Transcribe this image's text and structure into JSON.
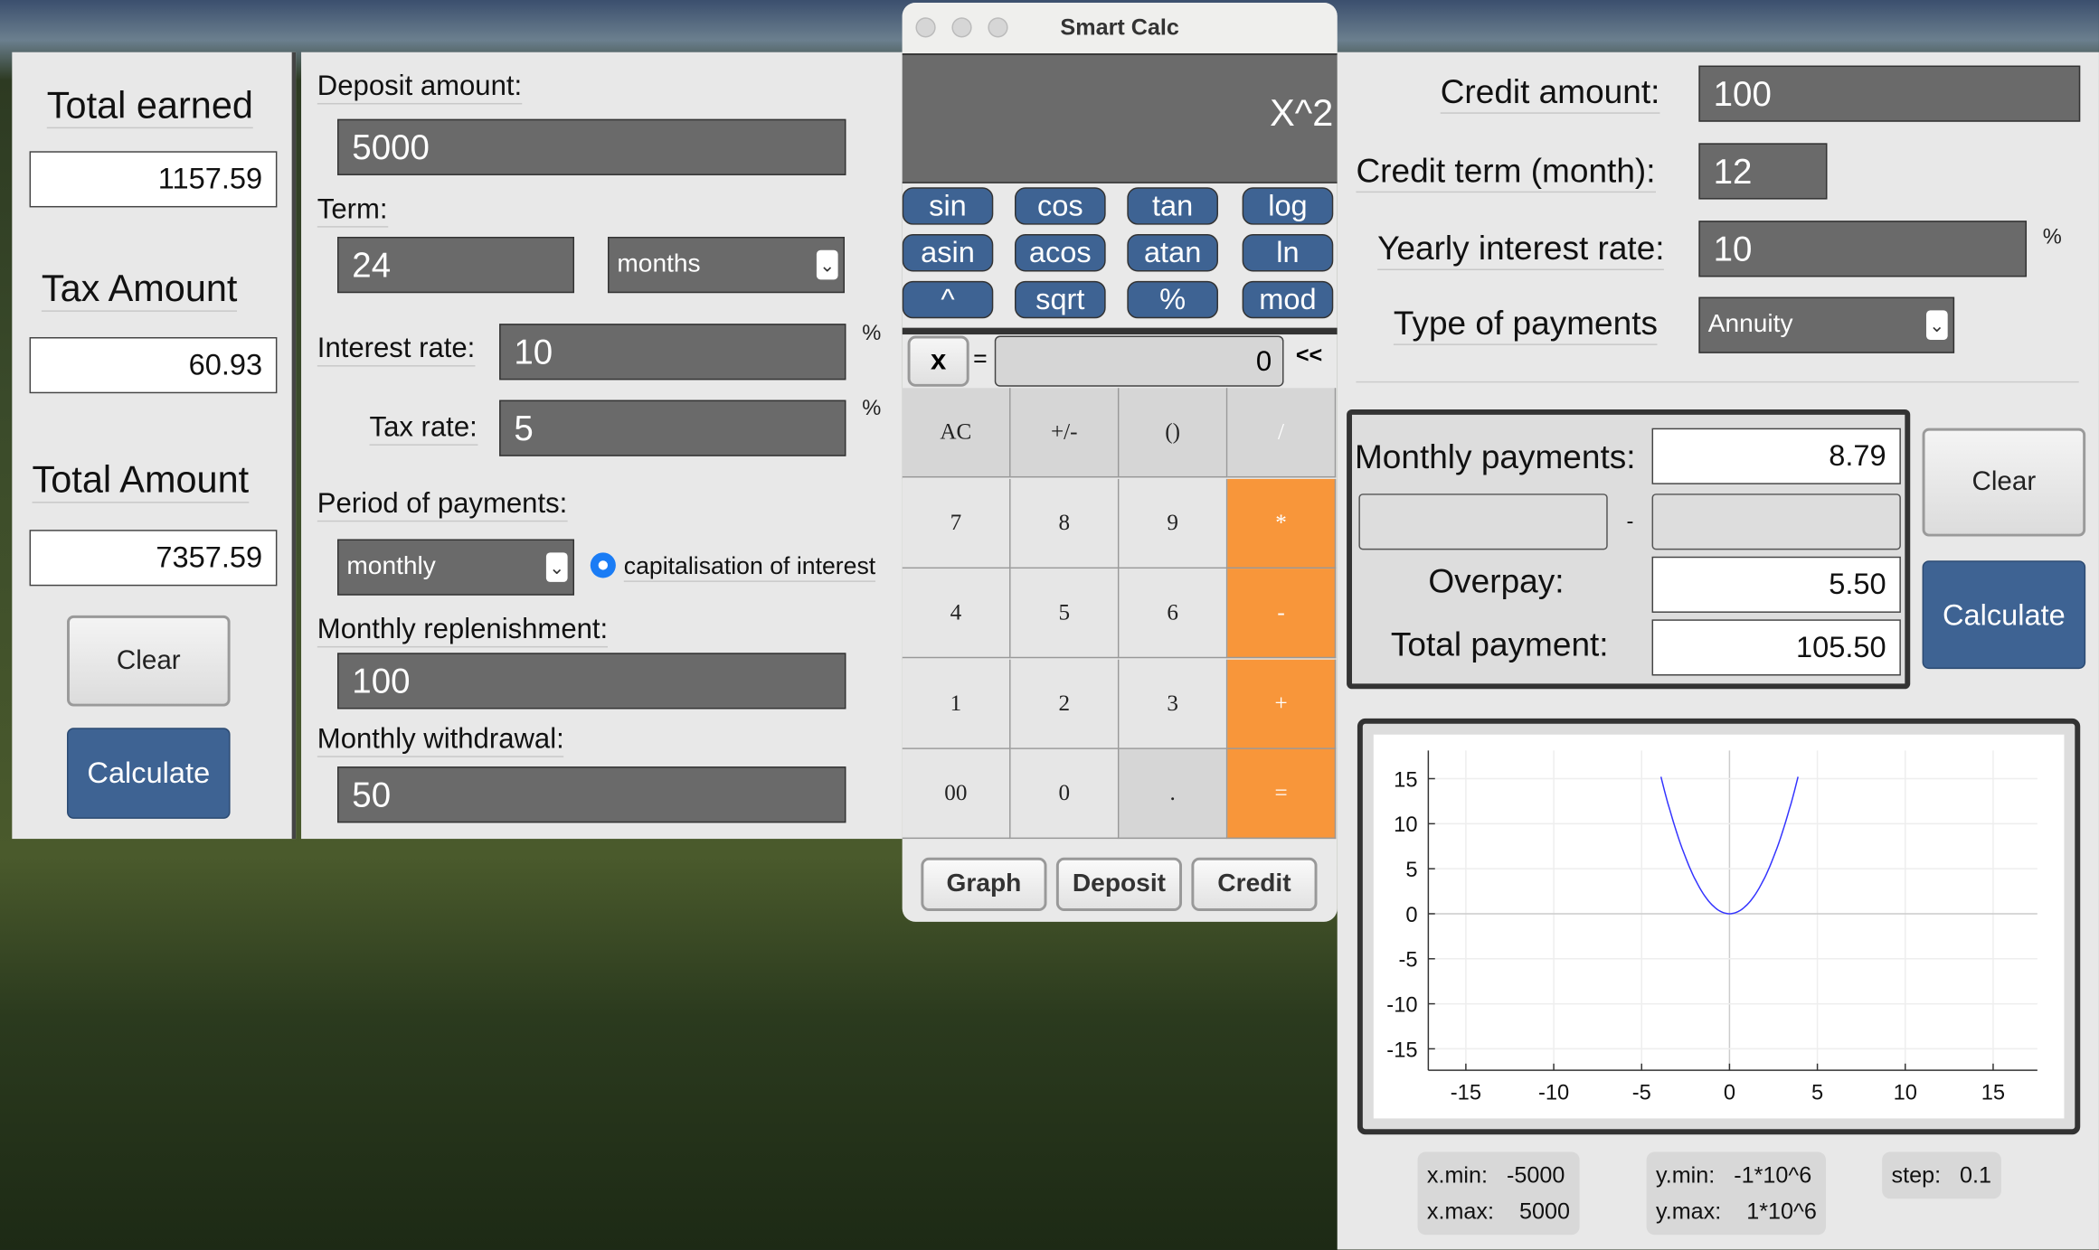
{
  "summary": {
    "total_earned_label": "Total earned",
    "total_earned": "1157.59",
    "tax_amount_label": "Tax Amount",
    "tax_amount": "60.93",
    "total_amount_label": "Total Amount",
    "total_amount": "7357.59",
    "clear": "Clear",
    "calculate": "Calculate"
  },
  "deposit": {
    "deposit_amount_label": "Deposit amount:",
    "deposit_amount": "5000",
    "term_label": "Term:",
    "term": "24",
    "term_unit": "months",
    "interest_rate_label": "Interest rate:",
    "interest_rate": "10",
    "tax_rate_label": "Tax rate:",
    "tax_rate": "5",
    "percent": "%",
    "period_label": "Period of payments:",
    "period": "monthly",
    "capitalisation_label": "capitalisation of interest",
    "replenishment_label": "Monthly replenishment:",
    "replenishment": "100",
    "withdrawal_label": "Monthly withdrawal:",
    "withdrawal": "50"
  },
  "calc": {
    "title": "Smart Calc",
    "display": "X^2",
    "functions": [
      "sin",
      "cos",
      "tan",
      "log",
      "asin",
      "acos",
      "atan",
      "ln",
      "^",
      "sqrt",
      "%",
      "mod"
    ],
    "x_button": "x",
    "equals_sign": "=",
    "x_value": "0",
    "backspace": "<<",
    "keys": [
      "AC",
      "+/-",
      "()",
      "/",
      "7",
      "8",
      "9",
      "*",
      "4",
      "5",
      "6",
      "-",
      "1",
      "2",
      "3",
      "+",
      "00",
      "0",
      ".",
      "="
    ],
    "modes": [
      "Graph",
      "Deposit",
      "Credit"
    ]
  },
  "credit": {
    "amount_label": "Credit amount:",
    "amount": "100",
    "term_label": "Credit term (month):",
    "term": "12",
    "rate_label": "Yearly interest rate:",
    "rate": "10",
    "percent": "%",
    "type_label": "Type of payments",
    "type": "Annuity",
    "monthly_label": "Monthly payments:",
    "monthly": "8.79",
    "range_sep": "-",
    "overpay_label": "Overpay:",
    "overpay": "5.50",
    "total_label": "Total payment:",
    "total": "105.50",
    "clear": "Clear",
    "calculate": "Calculate"
  },
  "graph_range": {
    "xmin_label": "x.min:",
    "xmin": "-5000",
    "xmax_label": "x.max:",
    "xmax": "5000",
    "ymin_label": "y.min:",
    "ymin": "-1*10^6",
    "ymax_label": "y.max:",
    "ymax": "1*10^6",
    "step_label": "step:",
    "step": "0.1"
  },
  "chart_data": {
    "type": "line",
    "function": "x^2",
    "xlim": [
      -17,
      17
    ],
    "ylim": [
      -17.5,
      17.5
    ],
    "xticks": [
      -15,
      -10,
      -5,
      0,
      5,
      10,
      15
    ],
    "yticks": [
      15,
      10,
      5,
      0,
      -5,
      -10,
      -15
    ],
    "xtick_labels": [
      "-15",
      "-10",
      "-5",
      "0",
      "5",
      "10",
      "15"
    ],
    "ytick_labels": [
      "15",
      "10",
      "5",
      "0",
      "-5",
      "-10",
      "-15"
    ],
    "grid": true,
    "series": [
      {
        "name": "x^2",
        "color": "#3333ff",
        "x_range": [
          -3.9,
          3.9
        ],
        "step": 0.1
      }
    ]
  }
}
